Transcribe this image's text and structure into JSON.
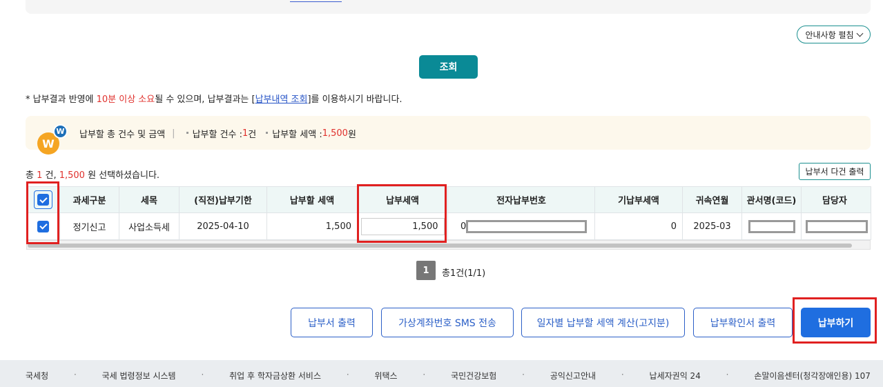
{
  "guide_toggle": "안내사항 펼침",
  "search_button": "조회",
  "notice": {
    "prefix": "* 납부결과 반영에 ",
    "highlight": "10분 이상 소요",
    "middle": "될 수 있으며, 납부결과는 [",
    "link": "납부내역 조회",
    "suffix": "]를 이용하시기 바랍니다."
  },
  "summary": {
    "logo_big": "W",
    "logo_small": "W",
    "title": "납부할 총 건수 및 금액",
    "count_label": "납부할 건수 : ",
    "count_value": "1",
    "count_unit": " 건",
    "amount_label": "납부할 세액 : ",
    "amount_value": "1,500",
    "amount_unit": " 원"
  },
  "selected": {
    "prefix": "총 ",
    "count": "1",
    "mid": " 건, ",
    "amount": "1,500",
    "suffix": " 원 선택하셨습니다."
  },
  "multi_print_button": "납부서 다건 출력",
  "table": {
    "headers": [
      "과세구분",
      "세목",
      "(직전)납부기한",
      "납부할 세액",
      "납부세액",
      "전자납부번호",
      "기납부세액",
      "귀속연월",
      "관서명(코드)",
      "담당자"
    ],
    "row": {
      "tax_type": "정기신고",
      "tax_item": "사업소득세",
      "due_date": "2025-04-10",
      "amount_due": "1,500",
      "payment_amount": "1,500",
      "electronic_no": "0",
      "prepaid": "0",
      "period": "2025-03"
    }
  },
  "pagination": {
    "page": "1",
    "total": "총1건(1/1)"
  },
  "buttons": {
    "print_bill": "납부서 출력",
    "virtual_sms": "가상계좌번호 SMS 전송",
    "daily_calc": "일자별 납부할 세액 계산(고지분)",
    "confirm_print": "납부확인서 출력",
    "pay": "납부하기"
  },
  "footer": [
    "국세청",
    "국세 법령정보 시스템",
    "취업 후 학자금상환 서비스",
    "위택스",
    "국민건강보험",
    "공익신고안내",
    "납세자권익 24",
    "손말이음센터(청각장애인용) 107"
  ],
  "footer_separator": "·"
}
